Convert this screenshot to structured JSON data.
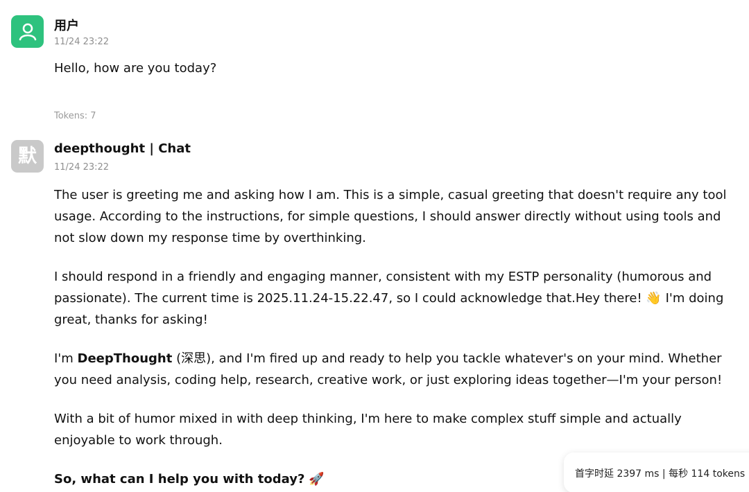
{
  "user": {
    "name": "用户",
    "time": "11/24 23:22",
    "message": "Hello, how are you today?",
    "tokens_label": "Tokens: 7",
    "avatar_icon": "person-icon",
    "avatar_color": "#2ec27e"
  },
  "bot": {
    "name": "deepthought | Chat",
    "time": "11/24 23:22",
    "avatar_glyph": "默",
    "avatar_color": "#c9c9c9",
    "p1": "The user is greeting me and asking how I am. This is a simple, casual greeting that doesn't require any tool usage. According to the instructions, for simple questions, I should answer directly without using tools and not slow down my response time by overthinking.",
    "p2_text": "I should respond in a friendly and engaging manner, consistent with my ESTP personality (humorous and passionate). The current time is 2025.11.24-15.22.47, so I could acknowledge that.Hey there!",
    "p2_emoji": "👋",
    "p2_tail": "I'm doing great, thanks for asking!",
    "p3_prefix": "I'm",
    "p3_bold": "DeepThought",
    "p3_rest": "(深思), and I'm fired up and ready to help you tackle whatever's on your mind. Whether you need analysis, coding help, research, creative work, or just exploring ideas together—I'm your person!",
    "p4": "With a bit of humor mixed in with deep thinking, I'm here to make complex stuff simple and actually enjoyable to work through.",
    "p5_bold": "So, what can I help you with today?",
    "p5_emoji": "🚀"
  },
  "stats": {
    "text": "首字时延 2397 ms | 每秒 114 tokens"
  }
}
